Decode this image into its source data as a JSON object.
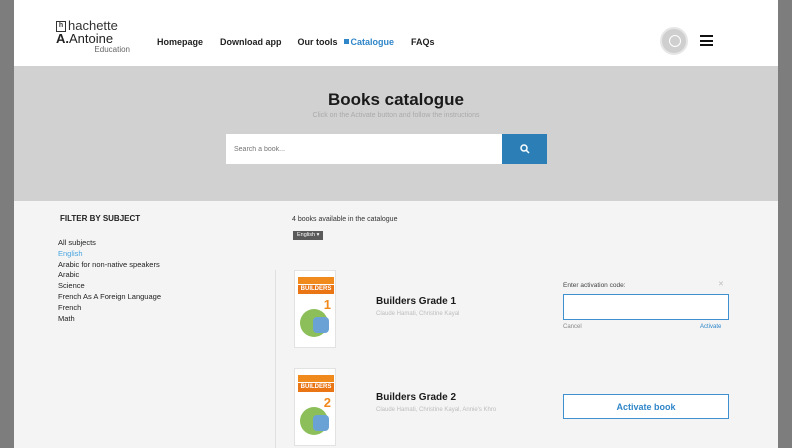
{
  "header": {
    "logo": {
      "line1": "hachette",
      "line2_bold": "A.",
      "line2": "Antoine",
      "line3": "Education"
    },
    "nav": [
      {
        "label": "Homepage"
      },
      {
        "label": "Download app"
      },
      {
        "label": "Our tools"
      },
      {
        "label": "Catalogue",
        "active": true
      },
      {
        "label": "FAQs"
      }
    ]
  },
  "hero": {
    "title": "Books catalogue",
    "subtitle": "Click on the Activate button and follow the instructions",
    "search_placeholder": "Search a book..."
  },
  "filter": {
    "title": "FILTER BY SUBJECT",
    "items": [
      {
        "label": "All subjects"
      },
      {
        "label": "English",
        "active": true
      },
      {
        "label": "Arabic for non-native speakers"
      },
      {
        "label": "Arabic"
      },
      {
        "label": "Science"
      },
      {
        "label": "French As A Foreign Language"
      },
      {
        "label": "French"
      },
      {
        "label": "Math"
      }
    ]
  },
  "catalogue": {
    "count_text": "4 books available in the catalogue",
    "language_chip": "English ▾",
    "books": [
      {
        "title": "Builders Grade 1",
        "cover_name": "BUILDERS",
        "grade_num": "1",
        "authors": "Claude Hamati, Christine Kayal"
      },
      {
        "title": "Builders Grade 2",
        "cover_name": "BUILDERS",
        "grade_num": "2",
        "authors": "Claude Hamati, Christine Kayal, Annie's Khro"
      }
    ],
    "activation": {
      "label": "Enter activation code:",
      "close": "✕",
      "cancel": "Cancel",
      "submit": "Activate"
    },
    "activate_button": "Activate book"
  },
  "colors": {
    "accent": "#2b7fb6",
    "active_link": "#2f86c8",
    "annotation_dots": "#c8262b",
    "cover_orange": "#f08a1c"
  }
}
